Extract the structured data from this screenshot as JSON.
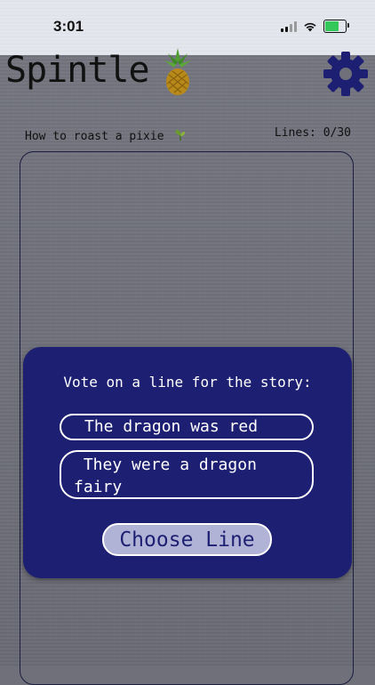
{
  "status_bar": {
    "time": "3:01",
    "icons": [
      "cellular-signal-icon",
      "wifi-icon",
      "battery-charging-icon"
    ],
    "battery_color": "#34c759"
  },
  "header": {
    "app_title": "Spintle",
    "logo_icon": "pineapple-icon",
    "settings_icon": "gear-icon"
  },
  "story": {
    "title": "How to roast a pixie",
    "title_icon": "plant-sprout-icon",
    "lines_label": "Lines: 0/30"
  },
  "vote_panel": {
    "prompt": "Vote on a line for the story:",
    "options": [
      {
        "label": "The dragon was red"
      },
      {
        "label": " They were a dragon fairy"
      }
    ],
    "choose_label": "Choose Line"
  },
  "colors": {
    "panel_bg": "#1d1f72",
    "accent": "#b1b3d6",
    "background": "#6f7079"
  }
}
